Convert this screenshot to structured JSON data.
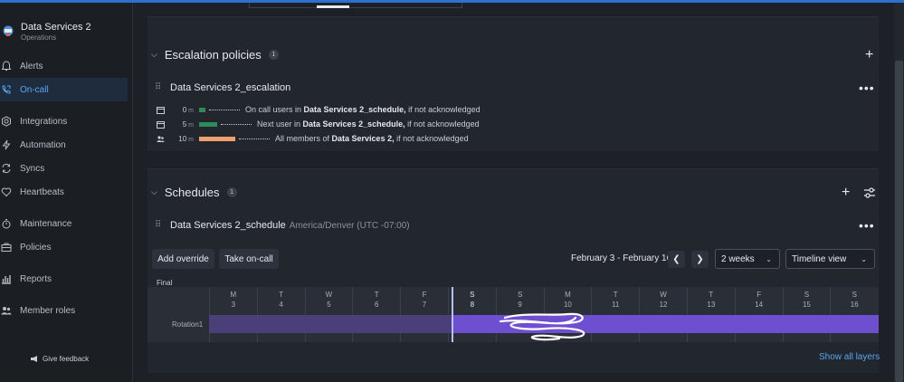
{
  "team": {
    "name": "Data Services 2",
    "subtitle": "Operations"
  },
  "sidebar": {
    "items": [
      {
        "label": "Alerts",
        "icon": "bell-icon"
      },
      {
        "label": "On-call",
        "icon": "phone-icon",
        "active": true
      },
      {
        "label": "Integrations",
        "icon": "integrations-icon"
      },
      {
        "label": "Automation",
        "icon": "lightning-icon"
      },
      {
        "label": "Syncs",
        "icon": "sync-icon"
      },
      {
        "label": "Heartbeats",
        "icon": "heart-icon"
      },
      {
        "label": "Maintenance",
        "icon": "stopwatch-icon"
      },
      {
        "label": "Policies",
        "icon": "briefcase-icon"
      },
      {
        "label": "Reports",
        "icon": "bar-chart-icon"
      },
      {
        "label": "Member roles",
        "icon": "users-icon"
      }
    ],
    "feedback": "Give feedback"
  },
  "escalation": {
    "title": "Escalation policies",
    "count": "1",
    "policy_name": "Data Services 2_escalation",
    "rules": [
      {
        "minutes": "0",
        "unit": "m",
        "color": "#2e8b57",
        "text_pre": "On call users in ",
        "target": "Data Services 2_schedule,",
        "text_post": " if not acknowledged",
        "icon": "calendar-icon"
      },
      {
        "minutes": "5",
        "unit": "m",
        "color": "#2e8b57",
        "text_pre": "Next user in ",
        "target": "Data Services 2_schedule,",
        "text_post": " if not acknowledged",
        "icon": "calendar-icon"
      },
      {
        "minutes": "10",
        "unit": "m",
        "color": "#f0a070",
        "text_pre": "All members of ",
        "target": "Data Services 2,",
        "text_post": " if not acknowledged",
        "icon": "team-icon"
      }
    ]
  },
  "schedules": {
    "title": "Schedules",
    "count": "1",
    "schedule_name": "Data Services 2_schedule",
    "timezone": "America/Denver (UTC -07:00)",
    "add_override": "Add override",
    "take_oncall": "Take on-call",
    "date_range": "February 3 - February 16",
    "period_select": "2 weeks",
    "view_select": "Timeline view",
    "final_label": "Final",
    "rotation_label": "Rotation1",
    "days": [
      {
        "d": "M",
        "n": "3"
      },
      {
        "d": "T",
        "n": "4"
      },
      {
        "d": "W",
        "n": "5"
      },
      {
        "d": "T",
        "n": "6"
      },
      {
        "d": "F",
        "n": "7"
      },
      {
        "d": "S",
        "n": "8"
      },
      {
        "d": "S",
        "n": "9"
      },
      {
        "d": "M",
        "n": "10"
      },
      {
        "d": "T",
        "n": "11"
      },
      {
        "d": "W",
        "n": "12"
      },
      {
        "d": "T",
        "n": "13"
      },
      {
        "d": "F",
        "n": "14"
      },
      {
        "d": "S",
        "n": "15"
      },
      {
        "d": "S",
        "n": "16"
      }
    ],
    "today_index": 5,
    "show_layers": "Show all layers"
  },
  "colors": {
    "accent": "#5aa4f5",
    "rotation": "#6e4fd0",
    "rotation_past": "#4b3f7a"
  }
}
